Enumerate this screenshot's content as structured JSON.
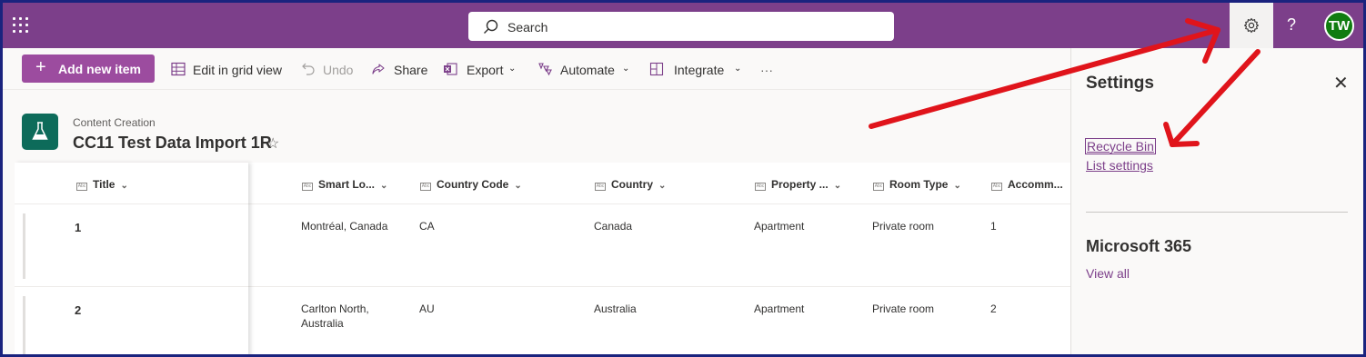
{
  "topbar": {
    "search_placeholder": "Search",
    "help_label": "?",
    "avatar_initials": "TW"
  },
  "commandbar": {
    "add_label": "Add new item",
    "grid_view_label": "Edit in grid view",
    "undo_label": "Undo",
    "share_label": "Share",
    "export_label": "Export",
    "automate_label": "Automate",
    "integrate_label": "Integrate",
    "more_label": "···"
  },
  "header": {
    "site_name": "Content Creation",
    "list_title": "CC11 Test Data Import 1R"
  },
  "table": {
    "columns": [
      "Title",
      "Smart Lo...",
      "Country Code",
      "Country",
      "Property ...",
      "Room Type",
      "Accomm..."
    ],
    "rows": [
      {
        "title": "1",
        "smart_location": "Montréal, Canada",
        "country_code": "CA",
        "country": "Canada",
        "property": "Apartment",
        "room_type": "Private room",
        "accommodates": "1"
      },
      {
        "title": "2",
        "smart_location": "Carlton North, Australia",
        "country_code": "AU",
        "country": "Australia",
        "property": "Apartment",
        "room_type": "Private room",
        "accommodates": "2"
      }
    ]
  },
  "settings_panel": {
    "title": "Settings",
    "links": [
      "Recycle Bin",
      "List settings"
    ],
    "section_title": "Microsoft 365",
    "view_all": "View all"
  },
  "colors": {
    "suite_bar": "#7c3f8a",
    "accent": "#9c4c9f",
    "list_icon": "#0d6b5a",
    "avatar": "#107c10",
    "annotation_arrows": "#e0141b"
  }
}
